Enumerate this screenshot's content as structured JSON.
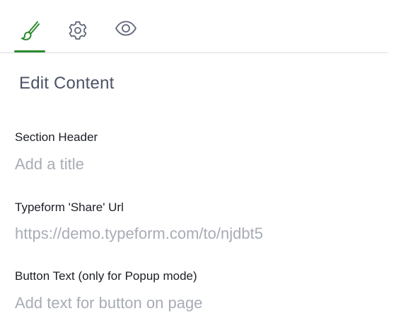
{
  "tabs": [
    {
      "icon": "paintbrush-icon",
      "active": true
    },
    {
      "icon": "gear-icon",
      "active": false
    },
    {
      "icon": "eye-icon",
      "active": false
    }
  ],
  "colors": {
    "accent": "#2e8b2e",
    "title": "#4d5466",
    "label": "#1c1f26",
    "placeholder": "#a8acb5",
    "icon": "#5f6678",
    "divider": "#d9dce1"
  },
  "panel": {
    "title": "Edit Content"
  },
  "fields": {
    "section_header": {
      "label": "Section Header",
      "placeholder": "Add a title",
      "value": ""
    },
    "share_url": {
      "label": "Typeform 'Share' Url",
      "placeholder": "https://demo.typeform.com/to/njdbt5",
      "value": ""
    },
    "button_text": {
      "label": "Button Text (only for Popup mode)",
      "placeholder": "Add text for button on page",
      "value": ""
    }
  }
}
